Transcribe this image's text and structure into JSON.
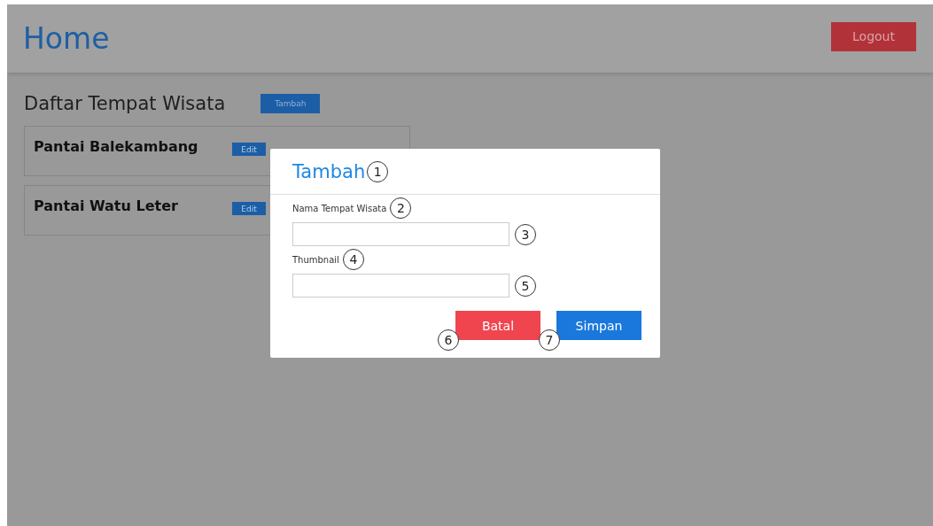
{
  "header": {
    "title": "Home",
    "logout": "Logout"
  },
  "section": {
    "title": "Daftar Tempat Wisata",
    "add_button": "Tambah"
  },
  "places": [
    {
      "name": "Pantai Balekambang",
      "edit": "Edit"
    },
    {
      "name": "Pantai Watu Leter",
      "edit": "Edit"
    }
  ],
  "dialog": {
    "title": "Tambah",
    "title_callout": "1",
    "fields": [
      {
        "label": "Nama Tempat Wisata",
        "label_callout": "2",
        "input_callout": "3"
      },
      {
        "label": "Thumbnail",
        "label_callout": "4",
        "input_callout": "5"
      }
    ],
    "buttons": [
      {
        "kind": "cancel",
        "label": "Batal",
        "callout": "6"
      },
      {
        "kind": "save",
        "label": "Simpan",
        "callout": "7"
      }
    ]
  }
}
